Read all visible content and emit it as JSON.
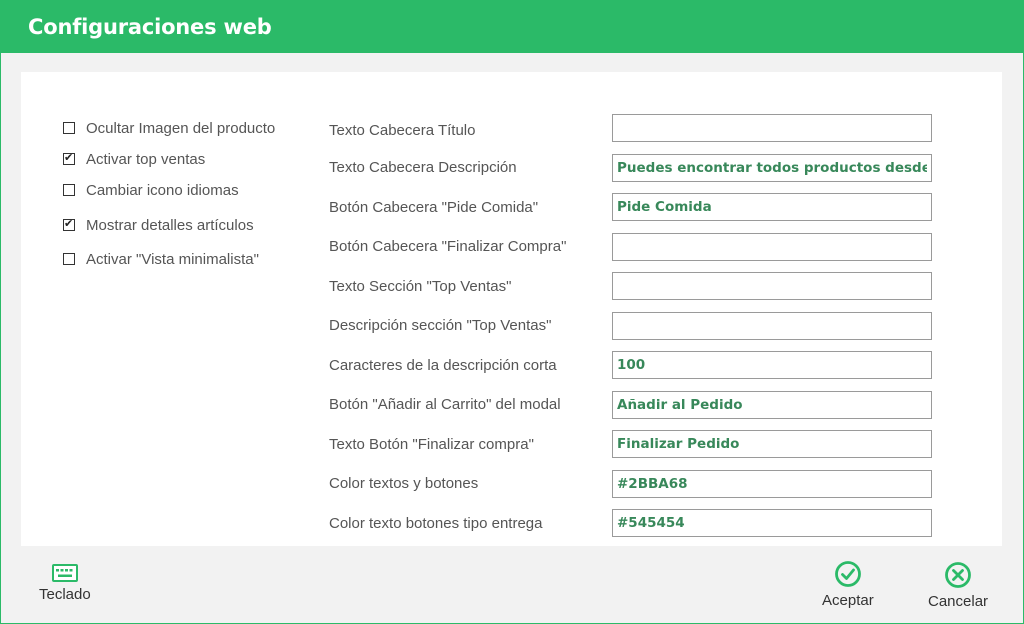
{
  "window": {
    "title": "Configuraciones web"
  },
  "colors": {
    "accent": "#2BBA68",
    "input_text": "#38885a"
  },
  "checkboxes": [
    {
      "label": "Ocultar Imagen del producto",
      "checked": false
    },
    {
      "label": "Activar top ventas",
      "checked": true
    },
    {
      "label": "Cambiar icono idiomas",
      "checked": false
    },
    {
      "label": "Mostrar detalles artículos",
      "checked": true
    },
    {
      "label": "Activar \"Vista minimalista\"",
      "checked": false
    }
  ],
  "fields": [
    {
      "label": "Texto Cabecera Título",
      "value": ""
    },
    {
      "label": "Texto Cabecera Descripción",
      "value": "Puedes encontrar todos productos desde nuestra web"
    },
    {
      "label": "Botón Cabecera \"Pide Comida\"",
      "value": "Pide Comida"
    },
    {
      "label": "Botón Cabecera \"Finalizar Compra\"",
      "value": ""
    },
    {
      "label": "Texto Sección \"Top Ventas\"",
      "value": ""
    },
    {
      "label": "Descripción sección \"Top Ventas\"",
      "value": ""
    },
    {
      "label": "Caracteres de la descripción corta",
      "value": "100"
    },
    {
      "label": "Botón \"Añadir al Carrito\" del modal",
      "value": "Añadir al Pedido"
    },
    {
      "label": "Texto Botón \"Finalizar compra\"",
      "value": "Finalizar Pedido"
    },
    {
      "label": "Color textos y botones",
      "value": "#2BBA68"
    },
    {
      "label": "Color texto botones tipo entrega",
      "value": "#545454"
    }
  ],
  "footer": {
    "keyboard": {
      "label": "Teclado",
      "icon": "keyboard-icon"
    },
    "accept": {
      "label": "Aceptar",
      "icon": "check-circle-icon"
    },
    "cancel": {
      "label": "Cancelar",
      "icon": "x-circle-icon"
    }
  }
}
